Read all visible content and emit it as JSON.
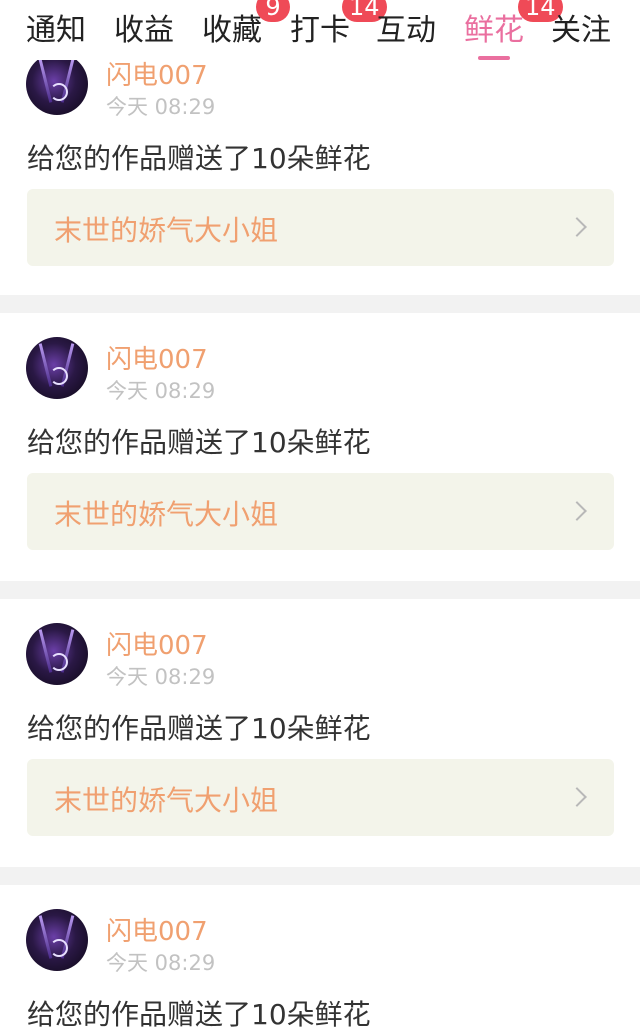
{
  "tabs": [
    {
      "label": "通知",
      "badge": null,
      "active": false
    },
    {
      "label": "收益",
      "badge": null,
      "active": false
    },
    {
      "label": "收藏",
      "badge": "9",
      "active": false
    },
    {
      "label": "打卡",
      "badge": "14",
      "active": false
    },
    {
      "label": "互动",
      "badge": null,
      "active": false
    },
    {
      "label": "鲜花",
      "badge": "14",
      "active": true
    },
    {
      "label": "关注",
      "badge": null,
      "active": false
    }
  ],
  "notifications": [
    {
      "username": "闪电007",
      "time": "今天 08:29",
      "message": "给您的作品赠送了10朵鲜花",
      "work_title": "末世的娇气大小姐"
    },
    {
      "username": "闪电007",
      "time": "今天 08:29",
      "message": "给您的作品赠送了10朵鲜花",
      "work_title": "末世的娇气大小姐"
    },
    {
      "username": "闪电007",
      "time": "今天 08:29",
      "message": "给您的作品赠送了10朵鲜花",
      "work_title": "末世的娇气大小姐"
    },
    {
      "username": "闪电007",
      "time": "今天 08:29",
      "message": "给您的作品赠送了10朵鲜花",
      "work_title": ""
    }
  ],
  "colors": {
    "accent": "#ea6f9f",
    "badge": "#ef4a57",
    "username": "#f0a070",
    "link_background": "#f3f4ea"
  },
  "icons": {
    "chevron": "chevron-right-icon",
    "avatar": "avatar"
  }
}
